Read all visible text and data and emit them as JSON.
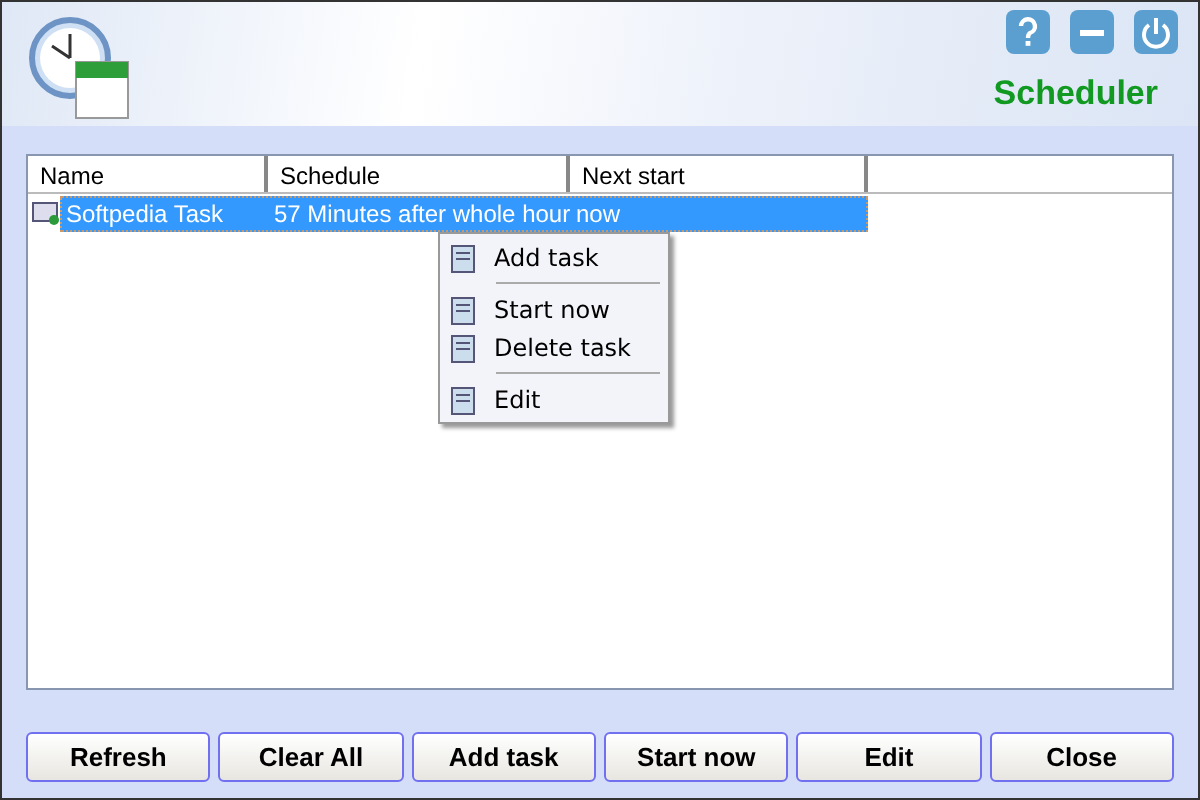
{
  "window": {
    "title": "Scheduler"
  },
  "table": {
    "columns": [
      "Name",
      "Schedule",
      "Next start"
    ],
    "rows": [
      {
        "name": "Softpedia Task",
        "schedule": "57 Minutes after whole hour",
        "next_start": "now",
        "selected": true
      }
    ]
  },
  "context_menu": [
    {
      "kind": "item",
      "label": "Add task"
    },
    {
      "kind": "separator"
    },
    {
      "kind": "item",
      "label": "Start now"
    },
    {
      "kind": "item",
      "label": "Delete task"
    },
    {
      "kind": "separator"
    },
    {
      "kind": "item",
      "label": "Edit"
    }
  ],
  "buttons": [
    "Refresh",
    "Clear All",
    "Add task",
    "Start now",
    "Edit",
    "Close"
  ]
}
